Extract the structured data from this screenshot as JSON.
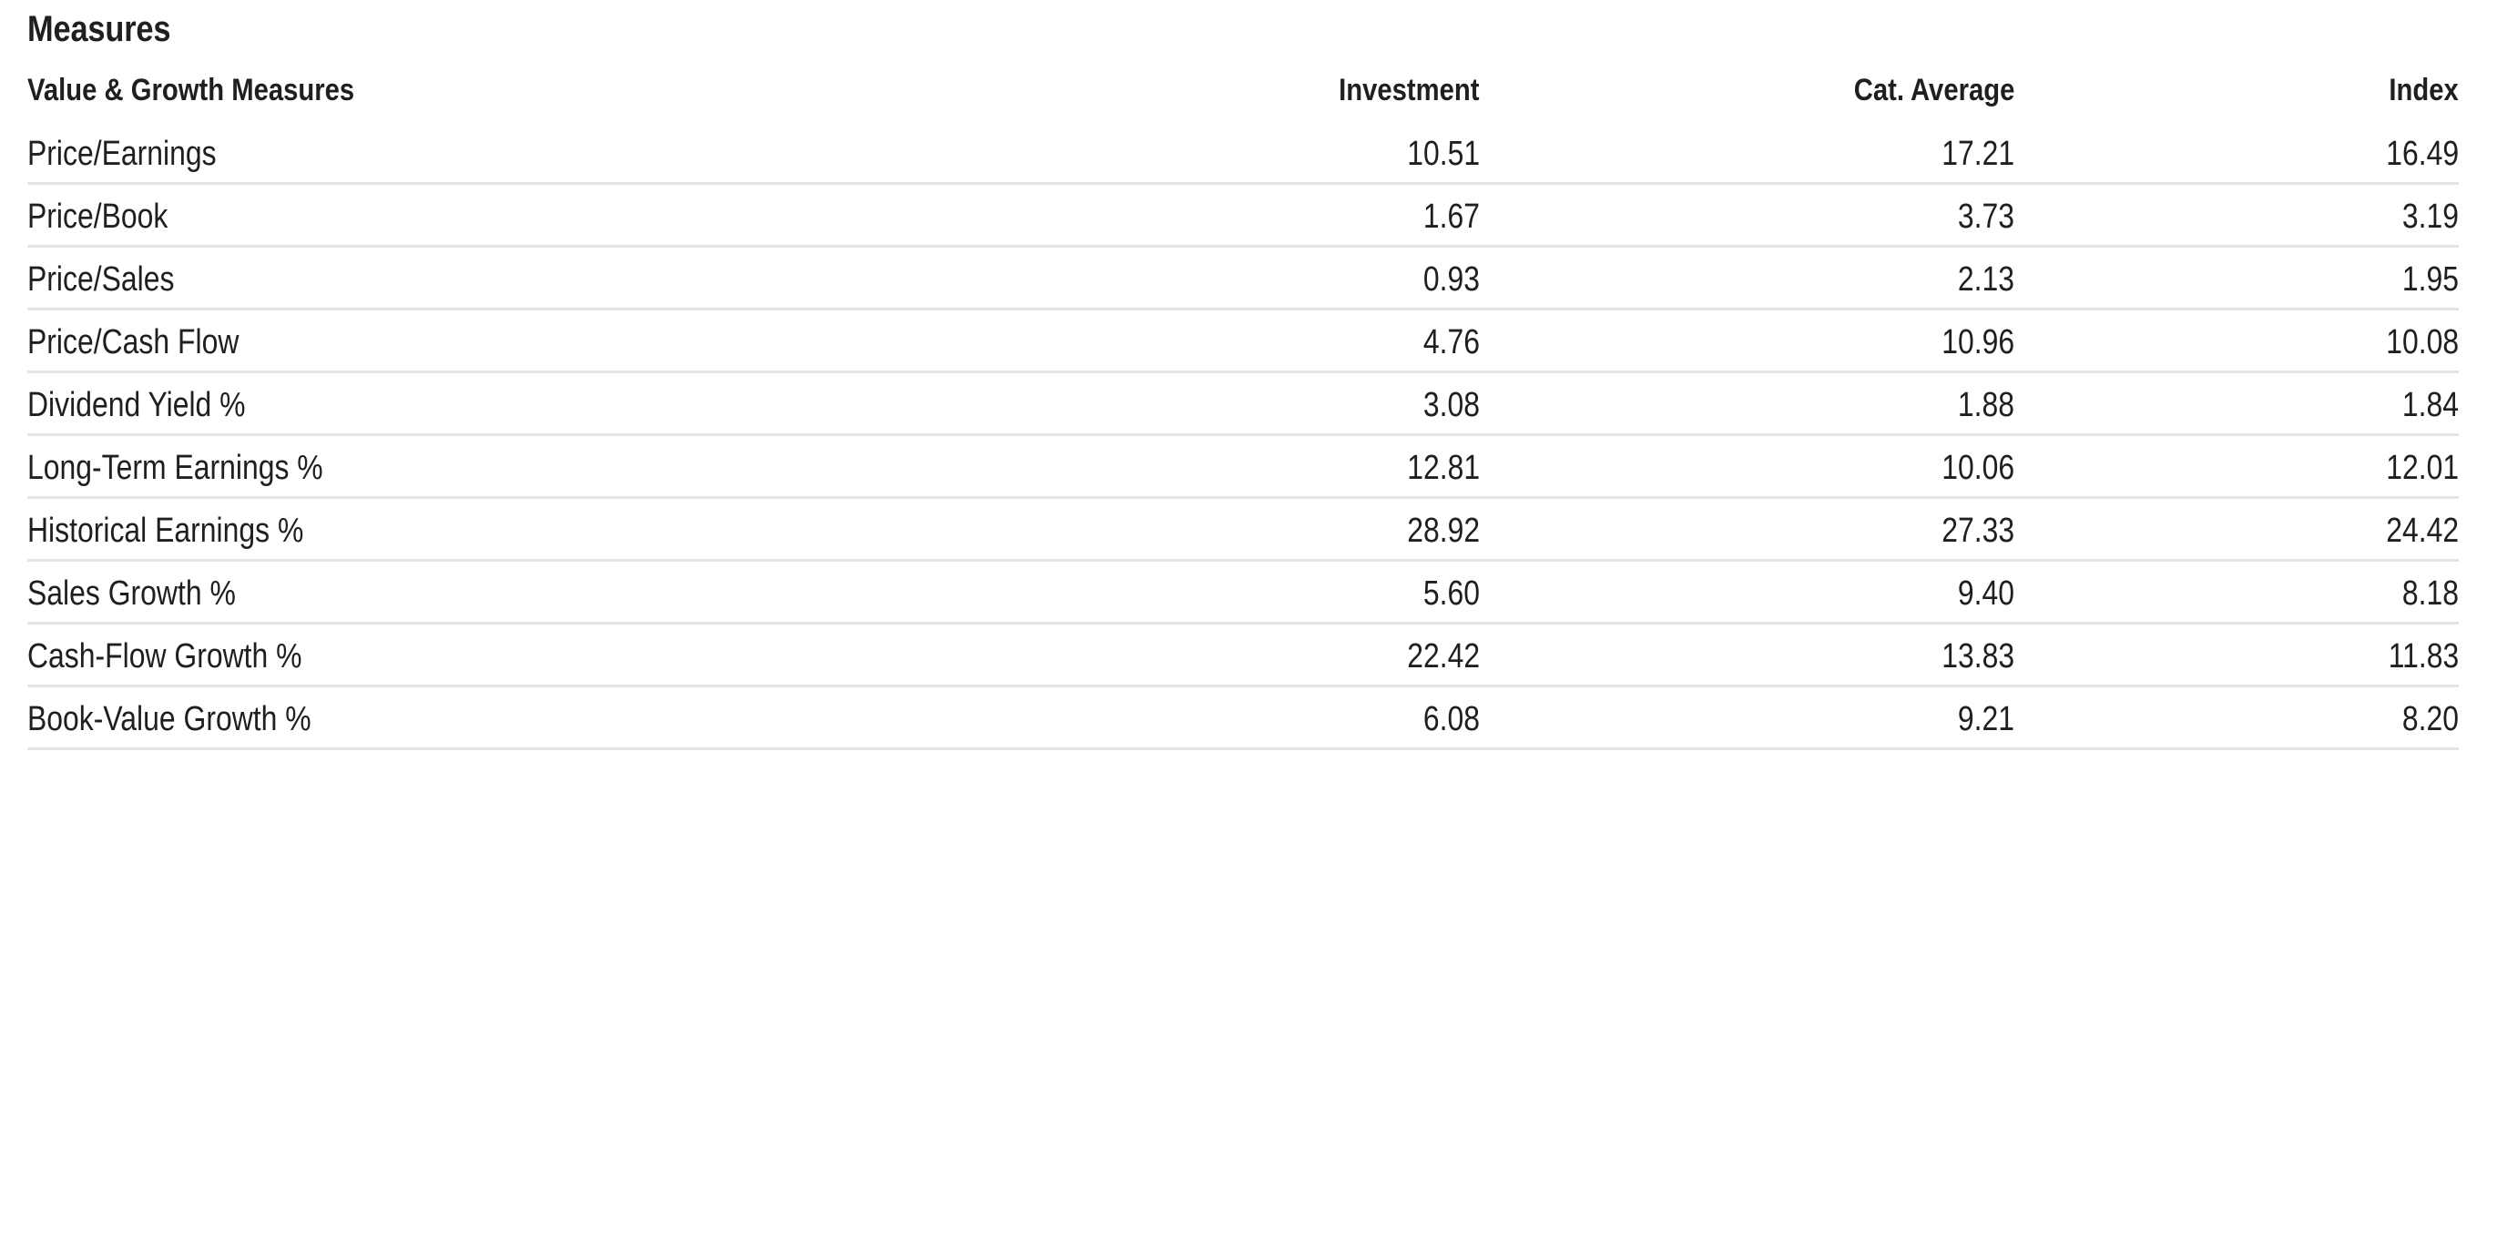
{
  "section": {
    "title": "Measures"
  },
  "table": {
    "headers": {
      "label": "Value & Growth Measures",
      "investment": "Investment",
      "cat_average": "Cat. Average",
      "index": "Index"
    },
    "rows": [
      {
        "label": "Price/Earnings",
        "investment": "10.51",
        "cat_average": "17.21",
        "index": "16.49"
      },
      {
        "label": "Price/Book",
        "investment": "1.67",
        "cat_average": "3.73",
        "index": "3.19"
      },
      {
        "label": "Price/Sales",
        "investment": "0.93",
        "cat_average": "2.13",
        "index": "1.95"
      },
      {
        "label": "Price/Cash Flow",
        "investment": "4.76",
        "cat_average": "10.96",
        "index": "10.08"
      },
      {
        "label": "Dividend Yield %",
        "investment": "3.08",
        "cat_average": "1.88",
        "index": "1.84"
      },
      {
        "label": "Long-Term Earnings %",
        "investment": "12.81",
        "cat_average": "10.06",
        "index": "12.01"
      },
      {
        "label": "Historical Earnings %",
        "investment": "28.92",
        "cat_average": "27.33",
        "index": "24.42"
      },
      {
        "label": "Sales Growth %",
        "investment": "5.60",
        "cat_average": "9.40",
        "index": "8.18"
      },
      {
        "label": "Cash-Flow Growth %",
        "investment": "22.42",
        "cat_average": "13.83",
        "index": "11.83"
      },
      {
        "label": "Book-Value Growth %",
        "investment": "6.08",
        "cat_average": "9.21",
        "index": "8.20"
      }
    ]
  },
  "colors": {
    "text": "#1f1f1f",
    "divider": "#e4e4e4",
    "background": "#ffffff"
  }
}
